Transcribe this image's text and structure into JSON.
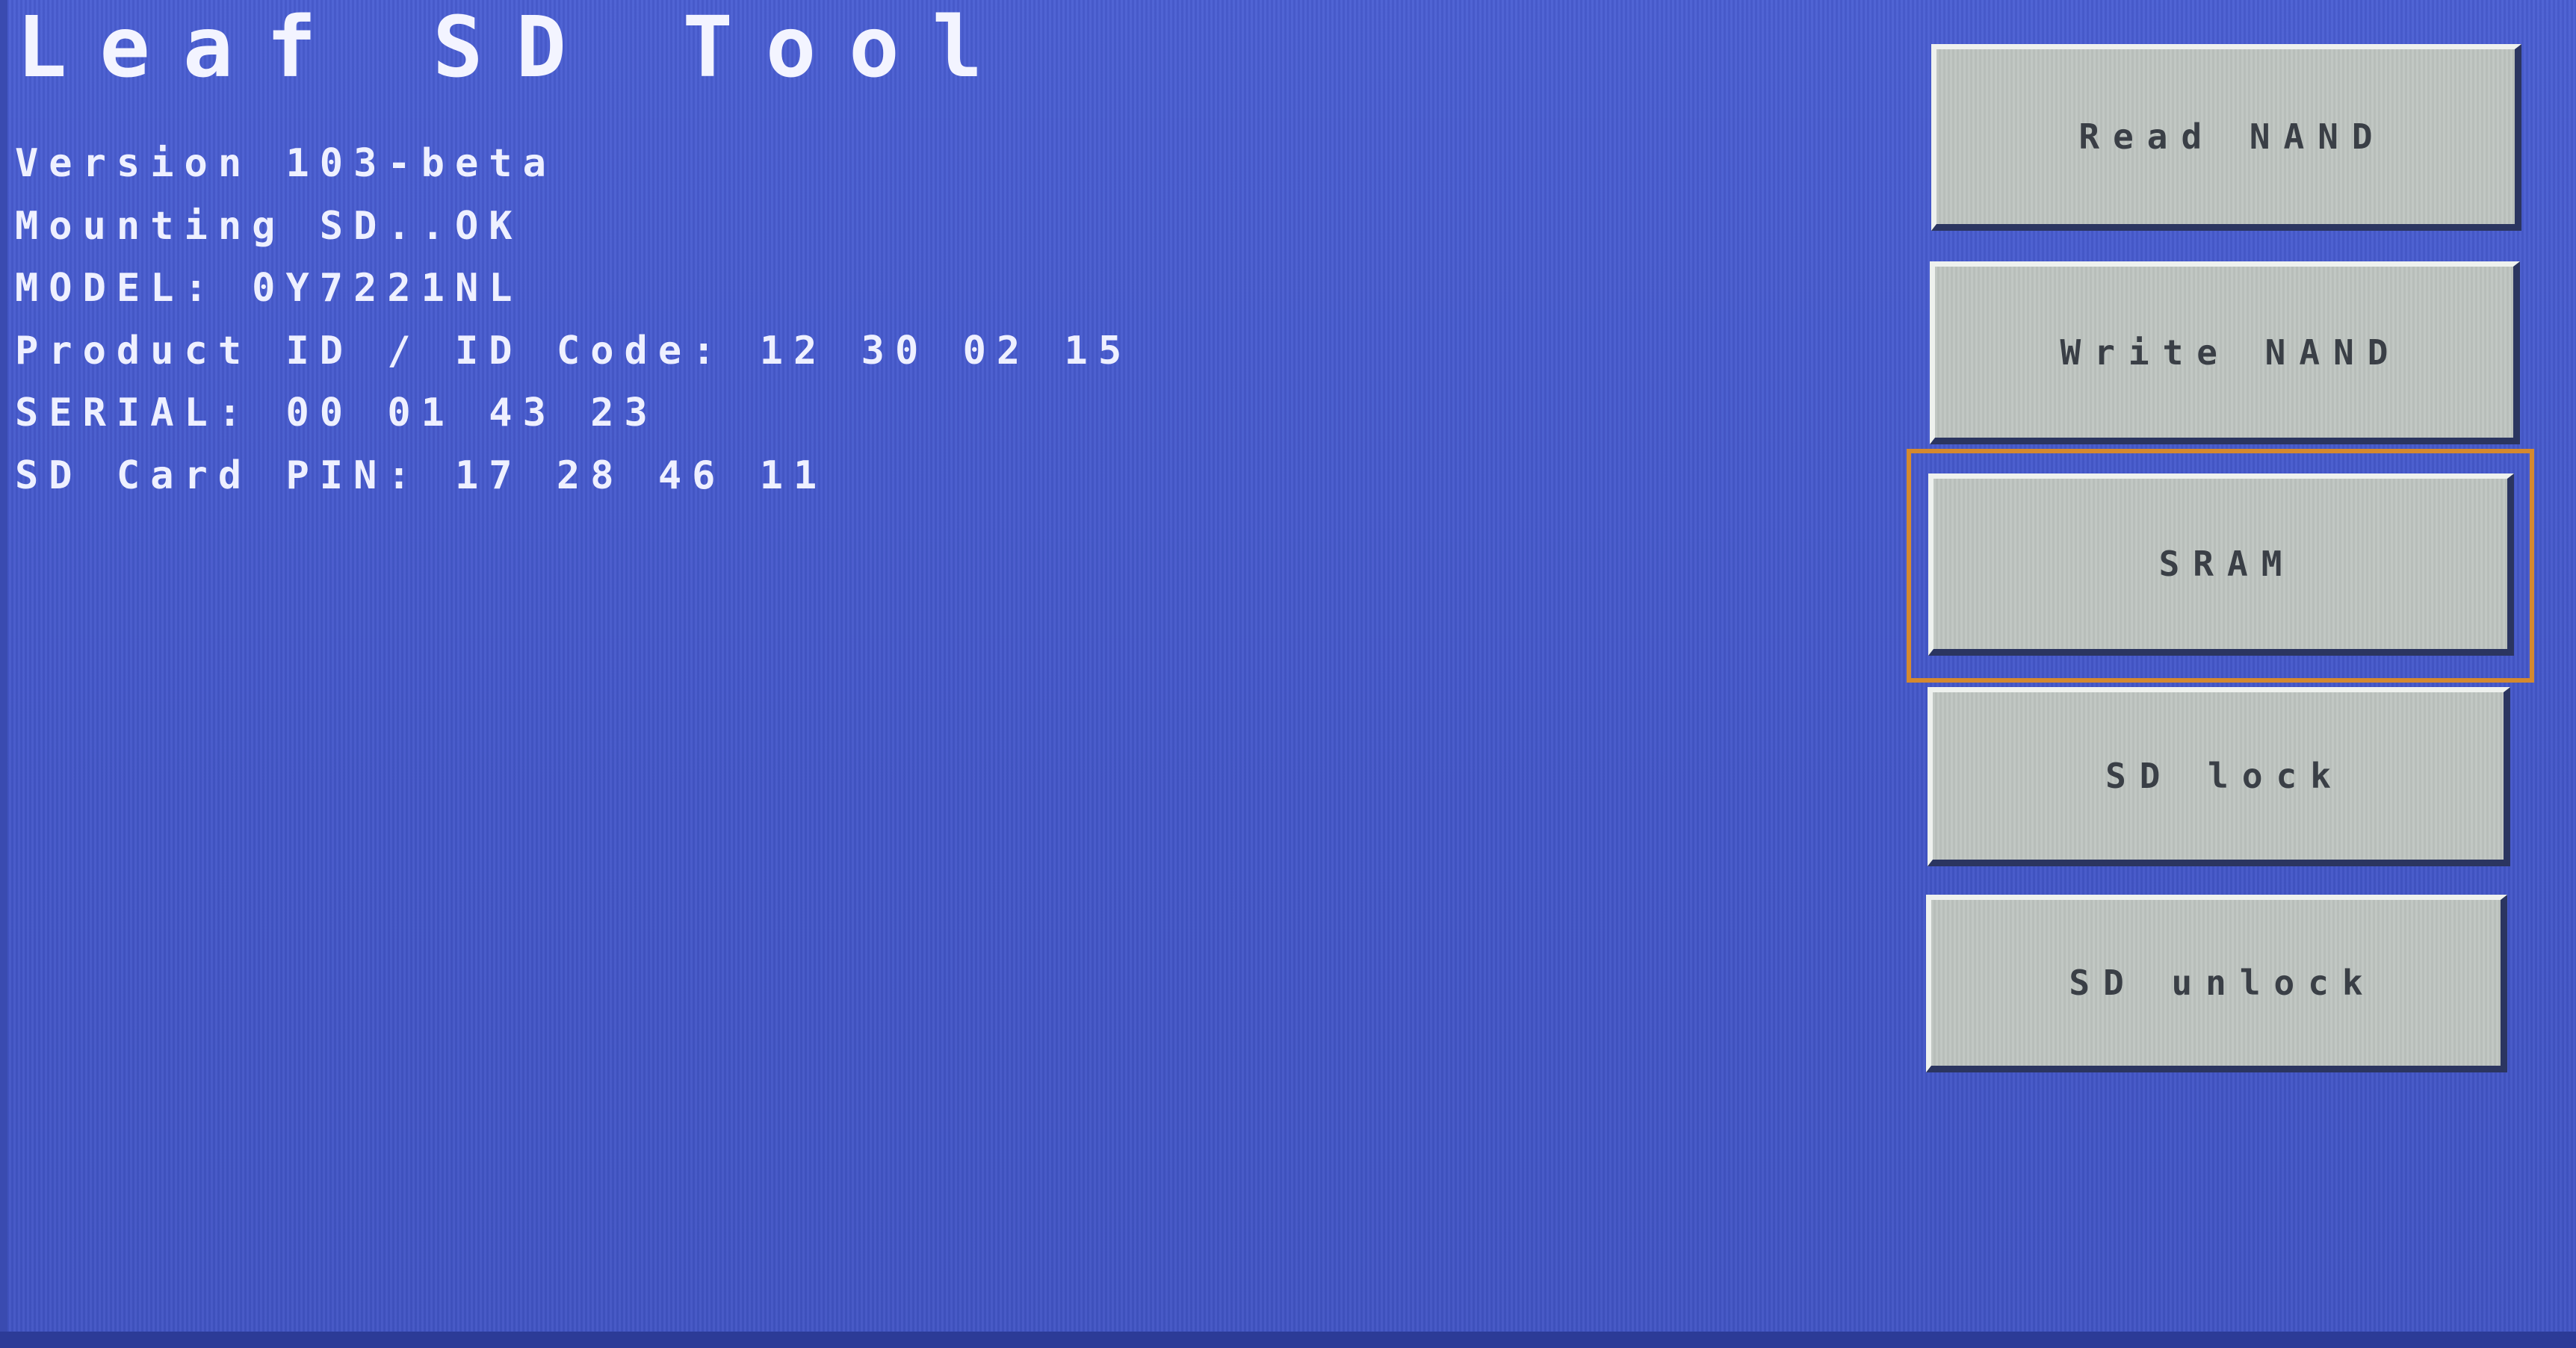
{
  "app": {
    "title": "Leaf SD Tool"
  },
  "info_lines": [
    "Version 103-beta",
    "Mounting SD..OK",
    "MODEL: 0Y7221NL",
    "Product ID / ID Code: 12 30 02 15",
    "SERIAL: 00 01 43 23",
    "SD Card PIN: 17 28 46 11"
  ],
  "buttons": {
    "read_nand": "Read NAND",
    "write_nand": "Write NAND",
    "sram": "SRAM",
    "sd_lock": "SD lock",
    "sd_unlock": "SD unlock"
  },
  "focused_button": "SRAM",
  "colors": {
    "background": "#4659cc",
    "text": "#eef0ff",
    "button_face": "#bec4c0",
    "focus_ring": "#d4892f"
  }
}
